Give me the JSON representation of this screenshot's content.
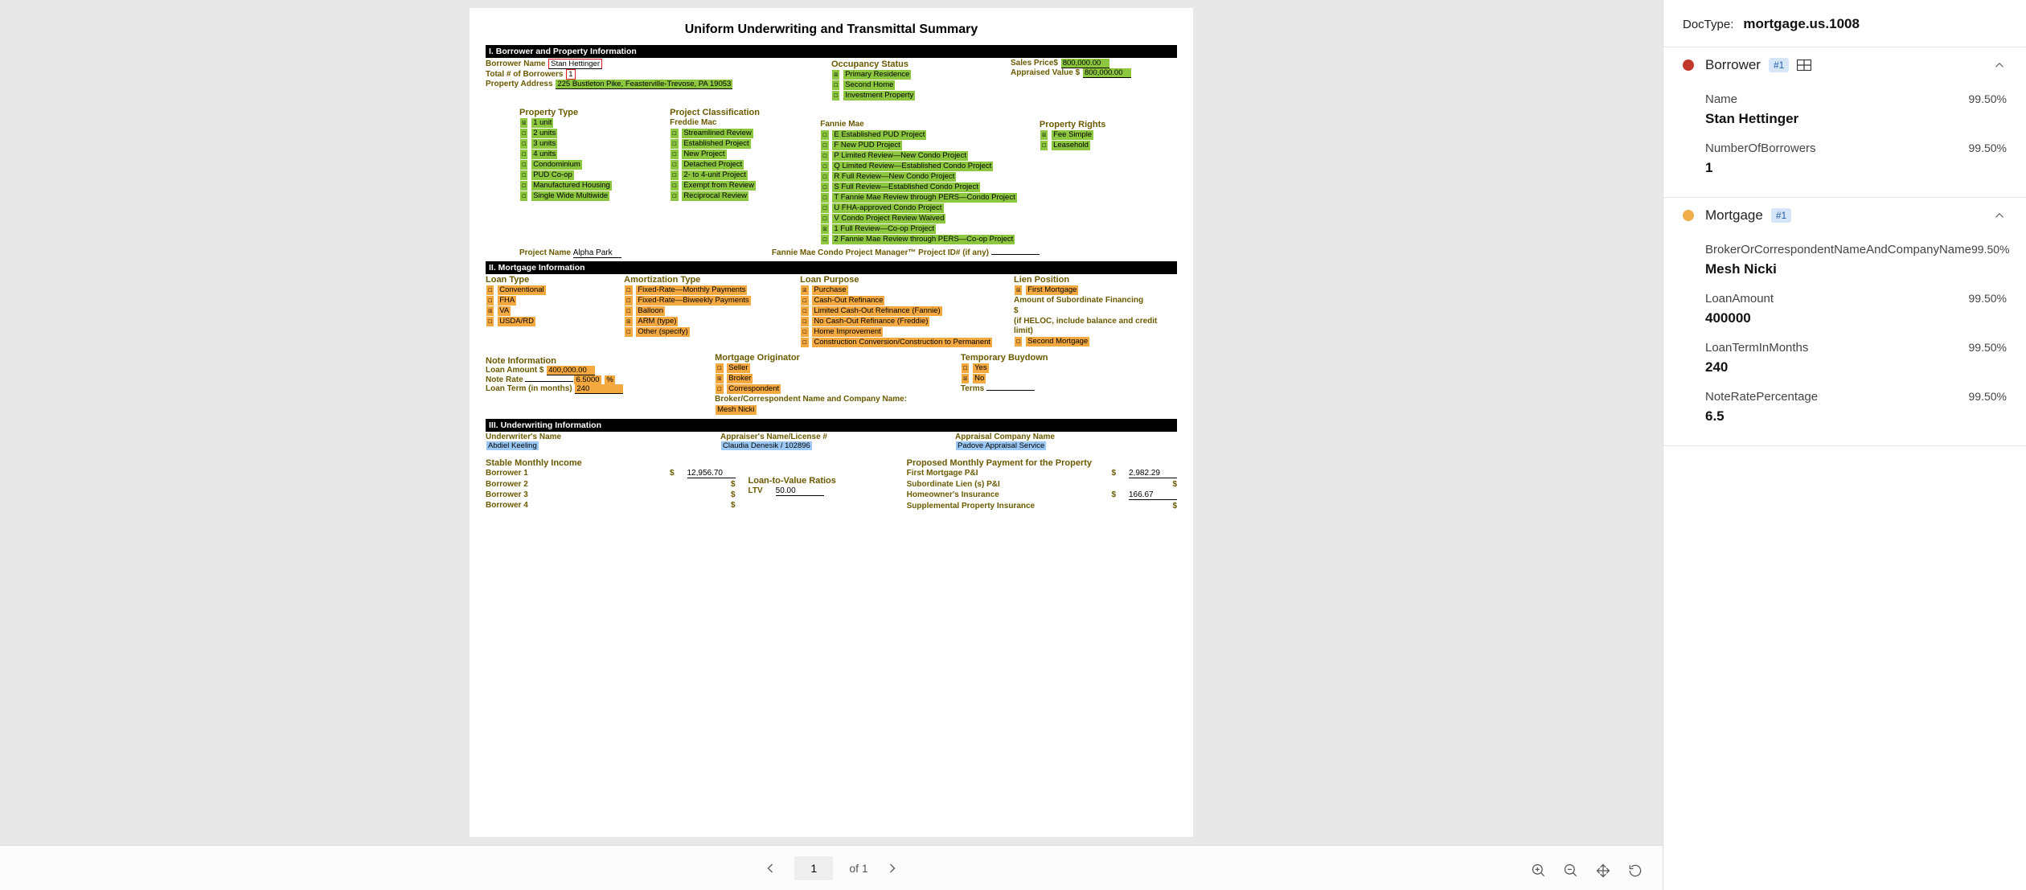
{
  "viewer": {
    "page_current": "1",
    "page_total": "of 1"
  },
  "meta": {
    "label": "DocType:",
    "value": "mortgage.us.1008"
  },
  "doc": {
    "title": "Uniform Underwriting and Transmittal Summary",
    "s1": "I. Borrower and Property Information",
    "s2": "II. Mortgage Information",
    "s3": "III. Underwriting Information",
    "borrower_name_lbl": "Borrower Name",
    "borrower_name": "Stan Hettinger",
    "total_borrowers_lbl": "Total # of Borrowers",
    "total_borrowers": "1",
    "prop_addr_lbl": "Property Address",
    "prop_addr": "225 Bustleton Pike, Feasterville-Trevose, PA 19053",
    "occ_lbl": "Occupancy Status",
    "occ_primary": "Primary Residence",
    "occ_second": "Second Home",
    "occ_invest": "Investment Property",
    "sales_price_lbl": "Sales Price$",
    "sales_price": "800,000.00",
    "appraised_lbl": "Appraised Value $",
    "appraised": "800,000.00",
    "prop_type_lbl": "Property Type",
    "pt": [
      "1 unit",
      "2 units",
      "3 units",
      "4 units",
      "Condominium",
      "PUD    Co-op",
      "Manufactured Housing",
      "Single Wide    Multiwide"
    ],
    "proj_class_lbl": "Project Classification",
    "freddie_lbl": "Freddie Mac",
    "fm": [
      "Streamlined Review",
      "Established Project",
      "New Project",
      "Detached Project",
      "2- to 4-unit Project",
      "Exempt from Review",
      "Reciprocal Review"
    ],
    "fannie_lbl": "Fannie Mae",
    "fn": [
      "E Established PUD Project",
      "F New PUD Project",
      "P Limited Review—New Condo Project",
      "Q Limited Review—Established Condo Project",
      "R Full Review—New Condo Project",
      "S Full Review—Established Condo Project",
      "T Fannie Mae Review through PERS—Condo Project",
      "U FHA-approved Condo Project",
      "V Condo Project Review Waived",
      "1 Full Review—Co-op Project",
      "2 Fannie Mae Review through PERS—Co-op Project"
    ],
    "prop_rights_lbl": "Property Rights",
    "pr_fee": "Fee Simple",
    "pr_lease": "Leasehold",
    "proj_name_lbl": "Project Name",
    "proj_name": "Alpha Park",
    "fannie_id_lbl": "Fannie Mae Condo Project Manager™ Project ID# (if any)",
    "loan_type_lbl": "Loan Type",
    "lt_conv": "Conventional",
    "lt_fha": "FHA",
    "lt_va": "VA",
    "lt_usda": "USDA/RD",
    "amort_lbl": "Amortization Type",
    "am": [
      "Fixed-Rate—Monthly Payments",
      "Fixed-Rate—Biweekly Payments",
      "Balloon",
      "ARM (type)",
      "Other (specify)"
    ],
    "loan_purpose_lbl": "Loan Purpose",
    "lp": [
      "Purchase",
      "Cash-Out Refinance",
      "Limited Cash-Out Refinance (Fannie)",
      "No Cash-Out Refinance (Freddie)",
      "Home Improvement",
      "Construction Conversion/Construction to Permanent"
    ],
    "lien_lbl": "Lien Position",
    "lien_first": "First Mortgage",
    "lien_sub_lbl": "Amount of Subordinate Financing",
    "lien_dollar": "$",
    "lien_heloc": "(if HELOC, include balance and credit limit)",
    "lien_second": "Second Mortgage",
    "note_info_lbl": "Note Information",
    "loan_amt_lbl": "Loan Amount $",
    "loan_amt": "400,000.00",
    "note_rate_lbl": "Note Rate",
    "note_rate": "6.5000",
    "note_rate_pct": "%",
    "loan_term_lbl": "Loan Term (in months)",
    "loan_term": "240",
    "mort_orig_lbl": "Mortgage Originator",
    "mo_seller": "Seller",
    "mo_broker": "Broker",
    "mo_corr": "Correspondent",
    "broker_name_lbl": "Broker/Correspondent Name and Company Name:",
    "broker_name": "Mesh Nicki",
    "temp_buy_lbl": "Temporary Buydown",
    "tb_yes": "Yes",
    "tb_no": "No",
    "terms_lbl": "Terms",
    "uw_name_lbl": "Underwriter's Name",
    "uw_name": "Abdiel Keeling",
    "app_name_lbl": "Appraiser's Name/License #",
    "app_name": "Claudia Denesik / 102896",
    "app_co_lbl": "Appraisal Company Name",
    "app_co": "Padove Appraisal Service",
    "smi_lbl": "Stable Monthly Income",
    "b1": "Borrower 1",
    "b2": "Borrower 2",
    "b3": "Borrower 3",
    "b4": "Borrower 4",
    "b1_amt": "12,956.70",
    "ltv_lbl": "Loan-to-Value Ratios",
    "ltv2": "LTV",
    "ltv2_val": "50.00",
    "pmp_lbl": "Proposed Monthly Payment for the Property",
    "pmp1": "First Mortgage P&I",
    "pmp1_val": "2,982.29",
    "pmp2": "Subordinate Lien (s) P&I",
    "pmp3": "Homeowner's Insurance",
    "pmp3_val": "166.67",
    "pmp4": "Supplemental Property Insurance"
  },
  "panel": {
    "sections": [
      {
        "title": "Borrower",
        "badge": "#1",
        "color": "red",
        "table": true,
        "fields": [
          {
            "name": "Name",
            "conf": "99.50%",
            "value": "Stan Hettinger"
          },
          {
            "name": "NumberOfBorrowers",
            "conf": "99.50%",
            "value": "1"
          }
        ]
      },
      {
        "title": "Mortgage",
        "badge": "#1",
        "color": "orange",
        "table": false,
        "fields": [
          {
            "name": "BrokerOrCorrespondentNameAndCompanyName",
            "conf": "99.50%",
            "value": "Mesh Nicki"
          },
          {
            "name": "LoanAmount",
            "conf": "99.50%",
            "value": "400000"
          },
          {
            "name": "LoanTermInMonths",
            "conf": "99.50%",
            "value": "240"
          },
          {
            "name": "NoteRatePercentage",
            "conf": "99.50%",
            "value": "6.5"
          }
        ]
      }
    ]
  }
}
